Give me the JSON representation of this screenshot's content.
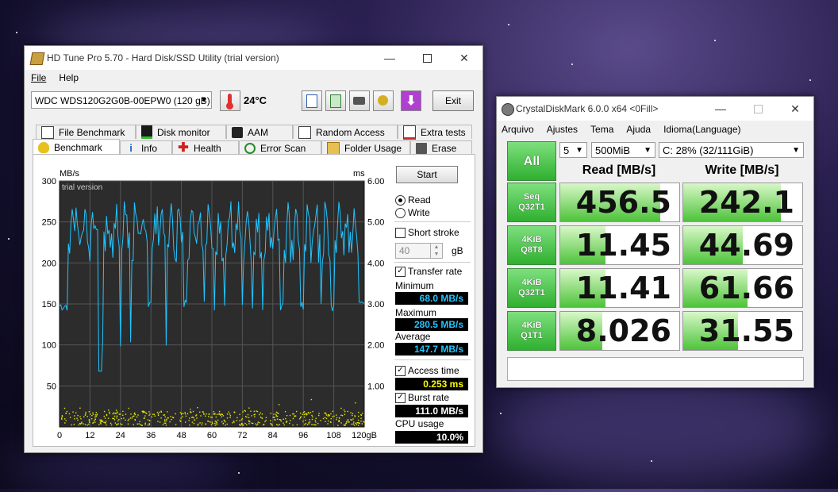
{
  "hdtune": {
    "title": "HD Tune Pro 5.70 - Hard Disk/SSD Utility (trial version)",
    "menu": [
      "File",
      "Help"
    ],
    "drive": "WDC WDS120G2G0B-00EPW0 (120 gB)",
    "temperature": "24°C",
    "exit_label": "Exit",
    "tabs_row1": [
      "File Benchmark",
      "Disk monitor",
      "AAM",
      "Random Access",
      "Extra tests"
    ],
    "tabs_row2": [
      "Benchmark",
      "Info",
      "Health",
      "Error Scan",
      "Folder Usage",
      "Erase"
    ],
    "start_label": "Start",
    "read_label": "Read",
    "write_label": "Write",
    "short_stroke_label": "Short stroke",
    "short_stroke_value": "40",
    "short_stroke_unit": "gB",
    "transfer_rate_label": "Transfer rate",
    "minimum_label": "Minimum",
    "minimum_value": "68.0 MB/s",
    "maximum_label": "Maximum",
    "maximum_value": "280.5 MB/s",
    "average_label": "Average",
    "average_value": "147.7 MB/s",
    "access_time_label": "Access time",
    "access_time_value": "0.253 ms",
    "burst_rate_label": "Burst rate",
    "burst_rate_value": "111.0 MB/s",
    "cpu_usage_label": "CPU usage",
    "cpu_usage_value": "10.0%",
    "chart_watermark": "trial version"
  },
  "chart_data": {
    "type": "line",
    "xlabel": "gB",
    "ylabel_left": "MB/s",
    "ylabel_right": "ms",
    "x_ticks": [
      "0",
      "12",
      "24",
      "36",
      "48",
      "60",
      "72",
      "84",
      "96",
      "108",
      "120gB"
    ],
    "y_left_ticks": [
      "300",
      "250",
      "200",
      "150",
      "100",
      "50"
    ],
    "y_right_ticks": [
      "6.00",
      "5.00",
      "4.00",
      "3.00",
      "2.00",
      "1.00"
    ],
    "xlim": [
      0,
      120
    ],
    "ylim_left": [
      0,
      300
    ],
    "ylim_right": [
      0,
      6
    ],
    "series": [
      {
        "name": "Transfer rate",
        "color": "#22c4ff",
        "baseline": 148,
        "spike_peak": 275,
        "low": 100
      },
      {
        "name": "Access time",
        "color": "#e8e800",
        "mean_ms": 0.253
      }
    ]
  },
  "cdm": {
    "title": "CrystalDiskMark 6.0.0 x64 <0Fill>",
    "menu": [
      "Arquivo",
      "Ajustes",
      "Tema",
      "Ajuda",
      "Idioma(Language)"
    ],
    "all_label": "All",
    "count": "5",
    "size": "500MiB",
    "drive": "C: 28% (32/111GiB)",
    "read_header": "Read [MB/s]",
    "write_header": "Write [MB/s]",
    "rows": [
      {
        "line1": "Seq",
        "line2": "Q32T1",
        "read": "456.5",
        "write": "242.1",
        "read_frac": 0.84,
        "write_frac": 0.82
      },
      {
        "line1": "4KiB",
        "line2": "Q8T8",
        "read": "11.45",
        "write": "44.69",
        "read_frac": 0.38,
        "write_frac": 0.5
      },
      {
        "line1": "4KiB",
        "line2": "Q32T1",
        "read": "11.41",
        "write": "61.66",
        "read_frac": 0.38,
        "write_frac": 0.54
      },
      {
        "line1": "4KiB",
        "line2": "Q1T1",
        "read": "8.026",
        "write": "31.55",
        "read_frac": 0.35,
        "write_frac": 0.46
      }
    ],
    "comment": ""
  }
}
